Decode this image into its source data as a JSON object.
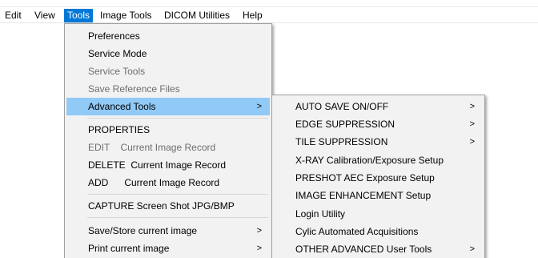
{
  "menubar": {
    "items": [
      {
        "label": "Edit"
      },
      {
        "label": "View"
      },
      {
        "label": "Tools",
        "active": true
      },
      {
        "label": "Image Tools"
      },
      {
        "label": "DICOM Utilities"
      },
      {
        "label": "Help"
      }
    ]
  },
  "tools_menu": {
    "items": [
      {
        "label": "Preferences",
        "enabled": true
      },
      {
        "label": "Service Mode",
        "enabled": true
      },
      {
        "label": "Service Tools",
        "enabled": false
      },
      {
        "label": "Save Reference Files",
        "enabled": false
      },
      {
        "label": "Advanced Tools",
        "enabled": true,
        "highlighted": true,
        "submenu_arrow": ">"
      },
      {
        "label": "PROPERTIES",
        "enabled": true
      },
      {
        "label": "EDIT    Current Image Record",
        "enabled": false
      },
      {
        "label": "DELETE  Current Image Record",
        "enabled": true
      },
      {
        "label": "ADD      Current Image Record",
        "enabled": true
      },
      {
        "label": "CAPTURE Screen Shot JPG/BMP",
        "enabled": true
      },
      {
        "label": "Save/Store current image",
        "enabled": true,
        "submenu_arrow": ">"
      },
      {
        "label": "Print current image",
        "enabled": true,
        "submenu_arrow": ">"
      }
    ]
  },
  "advanced_tools_menu": {
    "items": [
      {
        "label": "AUTO SAVE ON/OFF",
        "submenu_arrow": ">"
      },
      {
        "label": "EDGE SUPPRESSION",
        "submenu_arrow": ">"
      },
      {
        "label": "TILE SUPPRESSION",
        "submenu_arrow": ">"
      },
      {
        "label": "X-RAY Calibration/Exposure Setup"
      },
      {
        "label": "PRESHOT AEC Exposure Setup"
      },
      {
        "label": "IMAGE ENHANCEMENT Setup"
      },
      {
        "label": "Login Utility"
      },
      {
        "label": "Cylic Automated Acquisitions"
      },
      {
        "label": "OTHER ADVANCED User Tools",
        "submenu_arrow": ">"
      }
    ]
  },
  "colors": {
    "menubar_active": "#0078d7",
    "menu_highlight": "#91c9f7",
    "menu_background": "#f2f2f2",
    "disabled_text": "#6d6d6d"
  }
}
